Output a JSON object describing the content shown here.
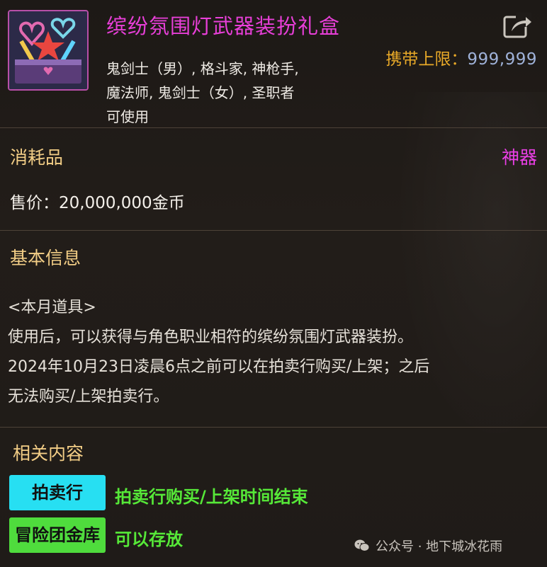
{
  "item": {
    "title": "缤纷氛围灯武器装扮礼盒",
    "classes": [
      "鬼剑士（男）, 格斗家, 神枪手,",
      "魔法师, 鬼剑士（女）, 圣职者",
      "可使用"
    ],
    "carry_label": "携带上限：",
    "carry_value": "999,999"
  },
  "info": {
    "type": "消耗品",
    "grade": "神器",
    "price": "售价：20,000,000金币"
  },
  "basic": {
    "title": "基本信息",
    "lines": [
      "<本月道具>",
      "使用后，可以获得与角色职业相符的缤纷氛围灯武器装扮。",
      "2024年10月23日凌晨6点之前可以在拍卖行购买/上架；之后",
      "无法购买/上架拍卖行。"
    ]
  },
  "related": {
    "title": "相关内容",
    "auction_label": "拍卖行",
    "auction_note": "拍卖行购买/上架时间结束",
    "bank_label": "冒险团金库",
    "bank_note": "可以存放"
  },
  "watermark": "公众号 · 地下城冰花雨",
  "icons": {
    "item": "gift-box-icon",
    "export": "share-export-icon",
    "watermark": "wechat-icon"
  },
  "colors": {
    "title": "#e83fd8",
    "grade": "#ea3fe6",
    "section": "#f3ce86",
    "carry_label": "#e8a928",
    "carry_value": "#9fb2d9",
    "auction_tag": "#27dff2",
    "bank_tag": "#4fdc3d",
    "note_green": "#56e838"
  }
}
